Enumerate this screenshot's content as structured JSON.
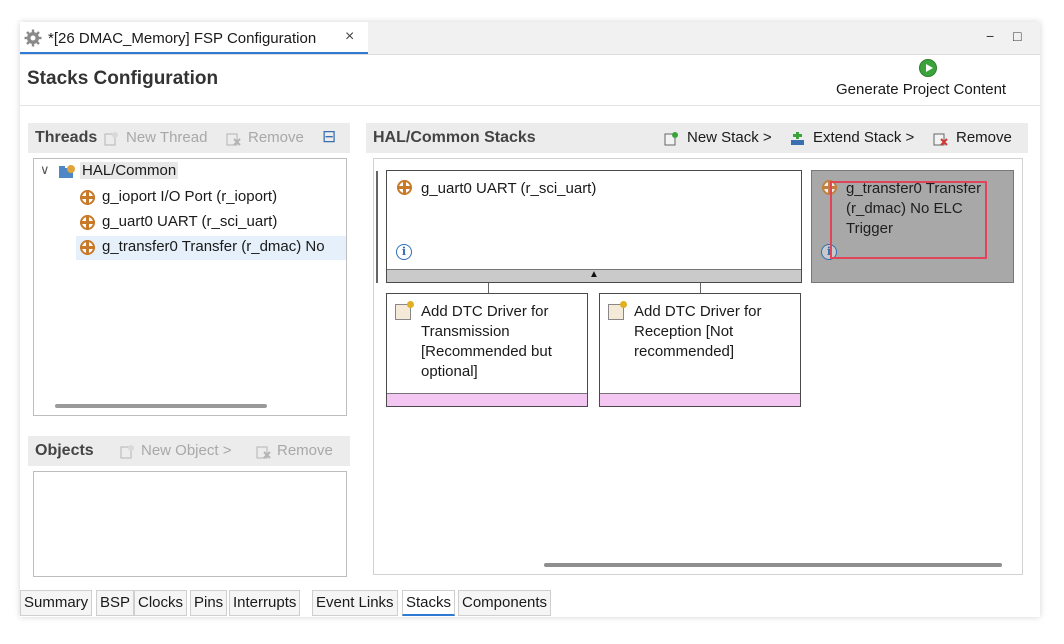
{
  "editor_tab": {
    "title": "*[26 DMAC_Memory] FSP Configuration",
    "close": "×"
  },
  "window_controls": {
    "minimize": "−",
    "maximize": "□"
  },
  "header": {
    "title": "Stacks Configuration",
    "generate_label": "Generate Project Content"
  },
  "threads": {
    "title": "Threads",
    "new_thread": "New Thread",
    "remove": "Remove",
    "collapse": "⊟",
    "tree": {
      "expander": "∨",
      "root": "HAL/Common",
      "children": [
        "g_ioport I/O Port (r_ioport)",
        "g_uart0 UART (r_sci_uart)",
        "g_transfer0 Transfer (r_dmac) No"
      ]
    }
  },
  "objects": {
    "title": "Objects",
    "new_object": "New Object >",
    "remove": "Remove"
  },
  "hal_stacks": {
    "title": "HAL/Common Stacks",
    "new_stack": "New Stack >",
    "extend_stack": "Extend Stack >",
    "remove": "Remove",
    "cards": {
      "uart": "g_uart0 UART (r_sci_uart)",
      "transfer_lines": [
        "g_transfer0 Transfer",
        "(r_dmac) No ELC",
        "Trigger"
      ],
      "dtc_tx_lines": [
        "Add DTC Driver for",
        "Transmission",
        "[Recommended but",
        "optional]"
      ],
      "dtc_rx_lines": [
        "Add DTC Driver for",
        "Reception [Not",
        "recommended]"
      ]
    },
    "info_glyph": "i",
    "up_arrow": "▲"
  },
  "bottom_tabs": [
    "Summary",
    "BSP",
    "Clocks",
    "Pins",
    "Interrupts",
    "Event Links",
    "Stacks",
    "Components"
  ],
  "active_tab": "Stacks",
  "colors": {
    "accent": "#2f7ad4",
    "selection": "#e6f0fb",
    "pink_footer": "#f4c6f2",
    "highlight_box": "#e0455a"
  }
}
